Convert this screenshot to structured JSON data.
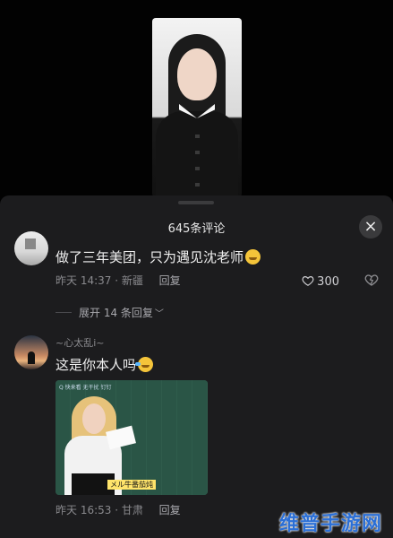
{
  "sheet": {
    "title": "645条评论",
    "close_icon": "×"
  },
  "comments": [
    {
      "text": "做了三年美团，只为遇见沈老师",
      "emoji": "smiling-face-icon",
      "time_location": "昨天 14:37 · 新疆",
      "reply_label": "回复",
      "likes": "300",
      "expand_label": "展开 14 条回复"
    },
    {
      "username": "~心太乱i~",
      "text": "这是你本人吗",
      "emoji": "laughing-crying-face-icon",
      "image_subtitle": "メル牛番茄炖",
      "image_top_text": "Q 快来看 无干扰 钉钉",
      "time_location": "昨天 16:53 · 甘肃",
      "reply_label": "回复"
    }
  ],
  "watermark": "维普手游网",
  "colors": {
    "sheet_bg": "#1c1c1e",
    "text_muted": "#8a8a8e",
    "watermark": "#2b6fd6"
  }
}
